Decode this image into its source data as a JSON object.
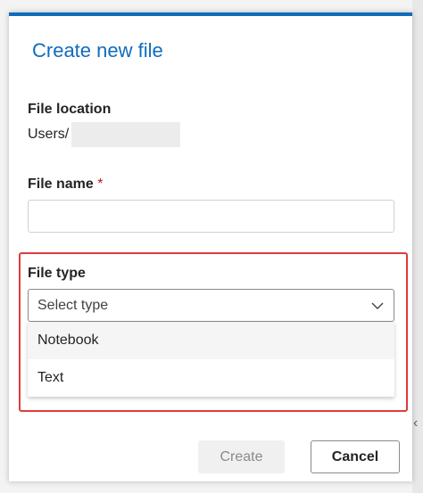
{
  "dialog": {
    "title": "Create new file",
    "file_location": {
      "label": "File location",
      "value": "Users/"
    },
    "file_name": {
      "label": "File name",
      "required_marker": "*",
      "value": ""
    },
    "file_type": {
      "label": "File type",
      "placeholder": "Select type",
      "options": [
        "Notebook",
        "Text"
      ]
    },
    "buttons": {
      "create": "Create",
      "cancel": "Cancel"
    }
  },
  "colors": {
    "accent": "#0f6cbd",
    "highlight_border": "#e03b3b",
    "required": "#c50f1f"
  },
  "icons": {
    "dropdown": "chevron-down-icon"
  }
}
